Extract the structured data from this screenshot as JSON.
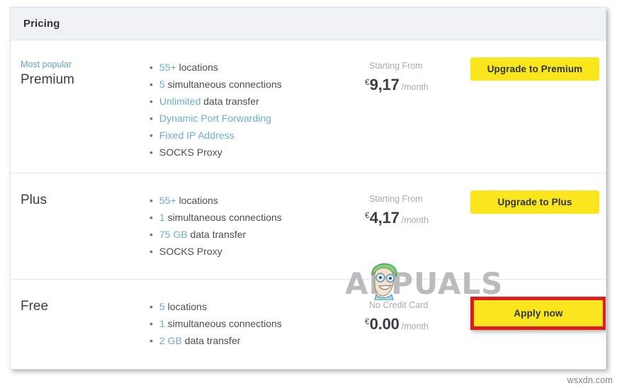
{
  "panel": {
    "title": "Pricing"
  },
  "plans": [
    {
      "badge": "Most popular",
      "name": "Premium",
      "features": [
        {
          "highlight": "55+",
          "rest": " locations"
        },
        {
          "highlight": "5",
          "rest": " simultaneous connections"
        },
        {
          "highlight": "Unlimited",
          "rest": " data transfer"
        },
        {
          "highlight": "Dynamic Port Forwarding",
          "rest": ""
        },
        {
          "highlight": "Fixed IP Address",
          "rest": ""
        },
        {
          "highlight": "",
          "rest": "SOCKS Proxy"
        }
      ],
      "price_caption": "Starting From",
      "currency": "€",
      "amount": "9,17",
      "period": "/month",
      "cta_label": "Upgrade to Premium",
      "cta_annotated": false
    },
    {
      "badge": "",
      "name": "Plus",
      "features": [
        {
          "highlight": "55+",
          "rest": " locations"
        },
        {
          "highlight": "1",
          "rest": " simultaneous connections"
        },
        {
          "highlight": "75 GB",
          "rest": " data transfer"
        },
        {
          "highlight": "",
          "rest": "SOCKS Proxy"
        }
      ],
      "price_caption": "Starting From",
      "currency": "€",
      "amount": "4,17",
      "period": "/month",
      "cta_label": "Upgrade to Plus",
      "cta_annotated": false
    },
    {
      "badge": "",
      "name": "Free",
      "features": [
        {
          "highlight": "5",
          "rest": " locations"
        },
        {
          "highlight": "1",
          "rest": " simultaneous connections"
        },
        {
          "highlight": "2 GB",
          "rest": " data transfer"
        }
      ],
      "price_caption": "No Credit Card",
      "currency": "€",
      "amount": "0.00",
      "period": "/month",
      "cta_label": "Apply now",
      "cta_annotated": true
    }
  ],
  "watermark": {
    "text": "APPUALS",
    "icon": "appuals-mascot-icon"
  },
  "site_tag": "wsxdn.com",
  "colors": {
    "cta_yellow": "#fbe51d",
    "annotation_red": "#e01b1b",
    "feature_highlight": "#6caec7",
    "header_bg": "#eff3f6"
  }
}
